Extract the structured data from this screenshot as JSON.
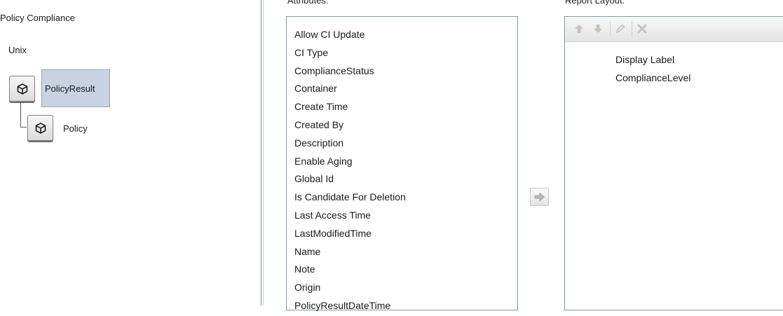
{
  "tree": {
    "title": "Policy Compliance",
    "root_label": "Unix",
    "nodes": [
      {
        "label": "PolicyResult",
        "icon": "cube-icon",
        "selected": true
      },
      {
        "label": "Policy",
        "icon": "cube-icon",
        "selected": false
      }
    ]
  },
  "attributes": {
    "header": "Attributes:",
    "items": [
      "Allow CI Update",
      "CI Type",
      "ComplianceStatus",
      "Container",
      "Create Time",
      "Created By",
      "Description",
      "Enable Aging",
      "Global Id",
      "Is Candidate For Deletion",
      "Last Access Time",
      "LastModifiedTime",
      "Name",
      "Note",
      "Origin",
      "PolicyResultDateTime"
    ]
  },
  "move_button": {
    "icon": "arrow-right-icon"
  },
  "layout": {
    "header": "Report Layout:",
    "toolbar": {
      "buttons": [
        {
          "name": "move-up",
          "icon": "arrow-up-icon"
        },
        {
          "name": "move-down",
          "icon": "arrow-down-icon"
        },
        {
          "name": "edit",
          "icon": "pencil-icon"
        },
        {
          "name": "delete",
          "icon": "x-icon"
        }
      ]
    },
    "items": [
      "Display Label",
      "ComplianceLevel"
    ]
  },
  "colors": {
    "selection": "#c7d3e3",
    "list_border": "#7c97b5",
    "disabled_icon": "#b5b5b5"
  }
}
